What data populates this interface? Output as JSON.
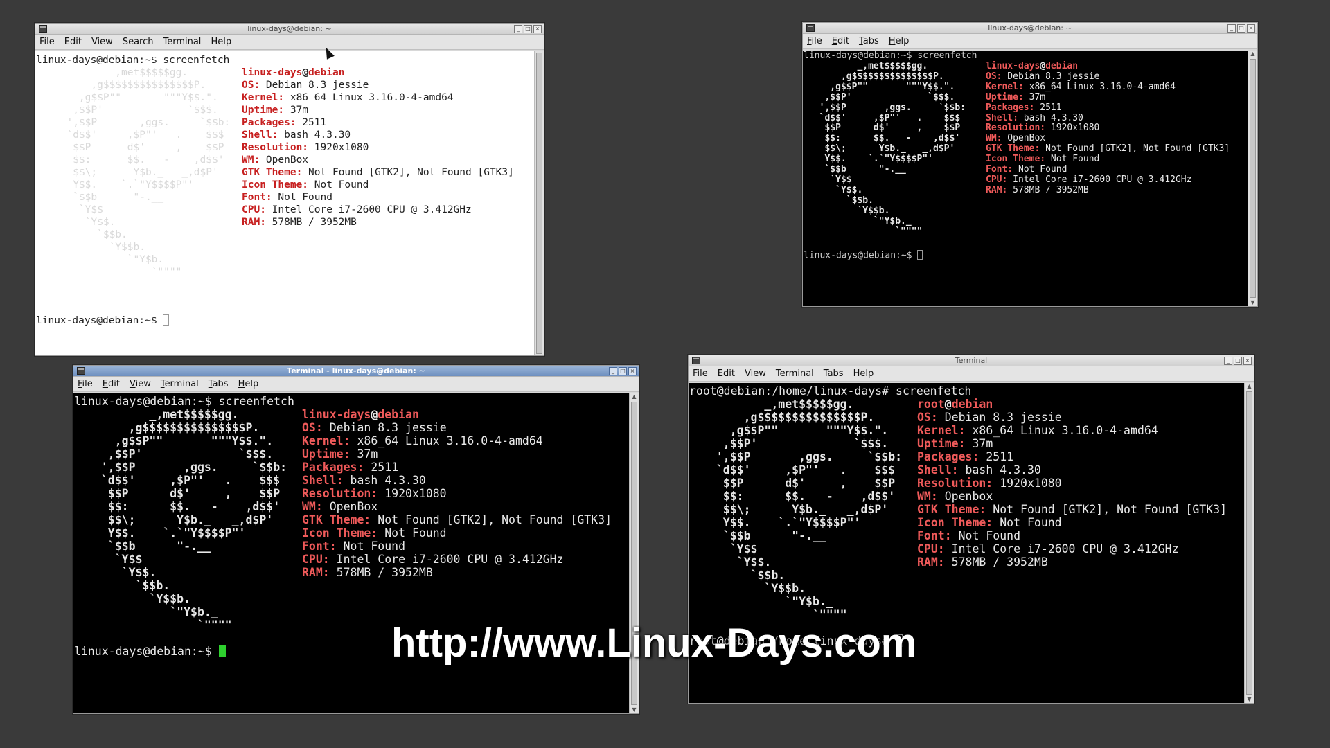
{
  "windows": [
    {
      "title": "linux-days@debian: ~",
      "menu": [
        "File",
        "Edit",
        "View",
        "Search",
        "Terminal",
        "Help"
      ],
      "prompt_cmd": "linux-days@debian:~$ screenfetch",
      "user": "linux-days",
      "host": "debian",
      "final_prompt": "linux-days@debian:~$ "
    },
    {
      "title": "linux-days@debian: ~",
      "menu": [
        "File",
        "Edit",
        "Tabs",
        "Help"
      ],
      "prompt_cmd": "linux-days@debian:~$ screenfetch",
      "user": "linux-days",
      "host": "debian",
      "final_prompt": "linux-days@debian:~$ "
    },
    {
      "title": "Terminal - linux-days@debian: ~",
      "menu": [
        "File",
        "Edit",
        "View",
        "Terminal",
        "Tabs",
        "Help"
      ],
      "prompt_cmd": "linux-days@debian:~$ screenfetch",
      "user": "linux-days",
      "host": "debian",
      "final_prompt": "linux-days@debian:~$ "
    },
    {
      "title": "Terminal",
      "menu": [
        "File",
        "Edit",
        "View",
        "Terminal",
        "Tabs",
        "Help"
      ],
      "prompt_cmd": "root@debian:/home/linux-days# screenfetch",
      "user": "root",
      "host": "debian",
      "final_prompt": "root@debian:/home/linux-days# "
    }
  ],
  "sysinfo": {
    "os": [
      "OS:",
      "Debian 8.3 jessie"
    ],
    "kernel": [
      "Kernel:",
      "x86_64 Linux 3.16.0-4-amd64"
    ],
    "uptime": [
      "Uptime:",
      "37m"
    ],
    "packages": [
      "Packages:",
      "2511"
    ],
    "shell": [
      "Shell:",
      "bash 4.3.30"
    ],
    "resolution": [
      "Resolution:",
      "1920x1080"
    ],
    "wm": [
      "WM:",
      "OpenBox"
    ],
    "wm_root": [
      "WM:",
      "Openbox"
    ],
    "gtk": [
      "GTK Theme:",
      "Not Found [GTK2], Not Found [GTK3]"
    ],
    "icon": [
      "Icon Theme:",
      "Not Found"
    ],
    "font": [
      "Font:",
      "Not Found"
    ],
    "cpu": [
      "CPU:",
      "Intel Core i7-2600 CPU @ 3.412GHz"
    ],
    "ram": [
      "RAM:",
      "578MB / 3952MB"
    ]
  },
  "logo": [
    "         _,met$$$$$gg.",
    "      ,g$$$$$$$$$$$$$$$P.",
    "    ,g$$P\"\"       \"\"\"Y$$.\".",
    "   ,$$P'              `$$$.",
    "  ',$$P       ,ggs.     `$$b:",
    "  `d$$'     ,$P\"'   .    $$$",
    "   $$P      d$'     ,    $$P",
    "   $$:      $$.   -    ,d$$'",
    "   $$\\;      Y$b._   _,d$P'",
    "   Y$$.    `.`\"Y$$$$P\"'",
    "   `$$b      \"-.__",
    "    `Y$$",
    "     `Y$$.",
    "       `$$b.",
    "         `Y$$b.",
    "            `\"Y$b._",
    "                `\"\"\"\""
  ],
  "watermark": "http://www.Linux-Days.com"
}
